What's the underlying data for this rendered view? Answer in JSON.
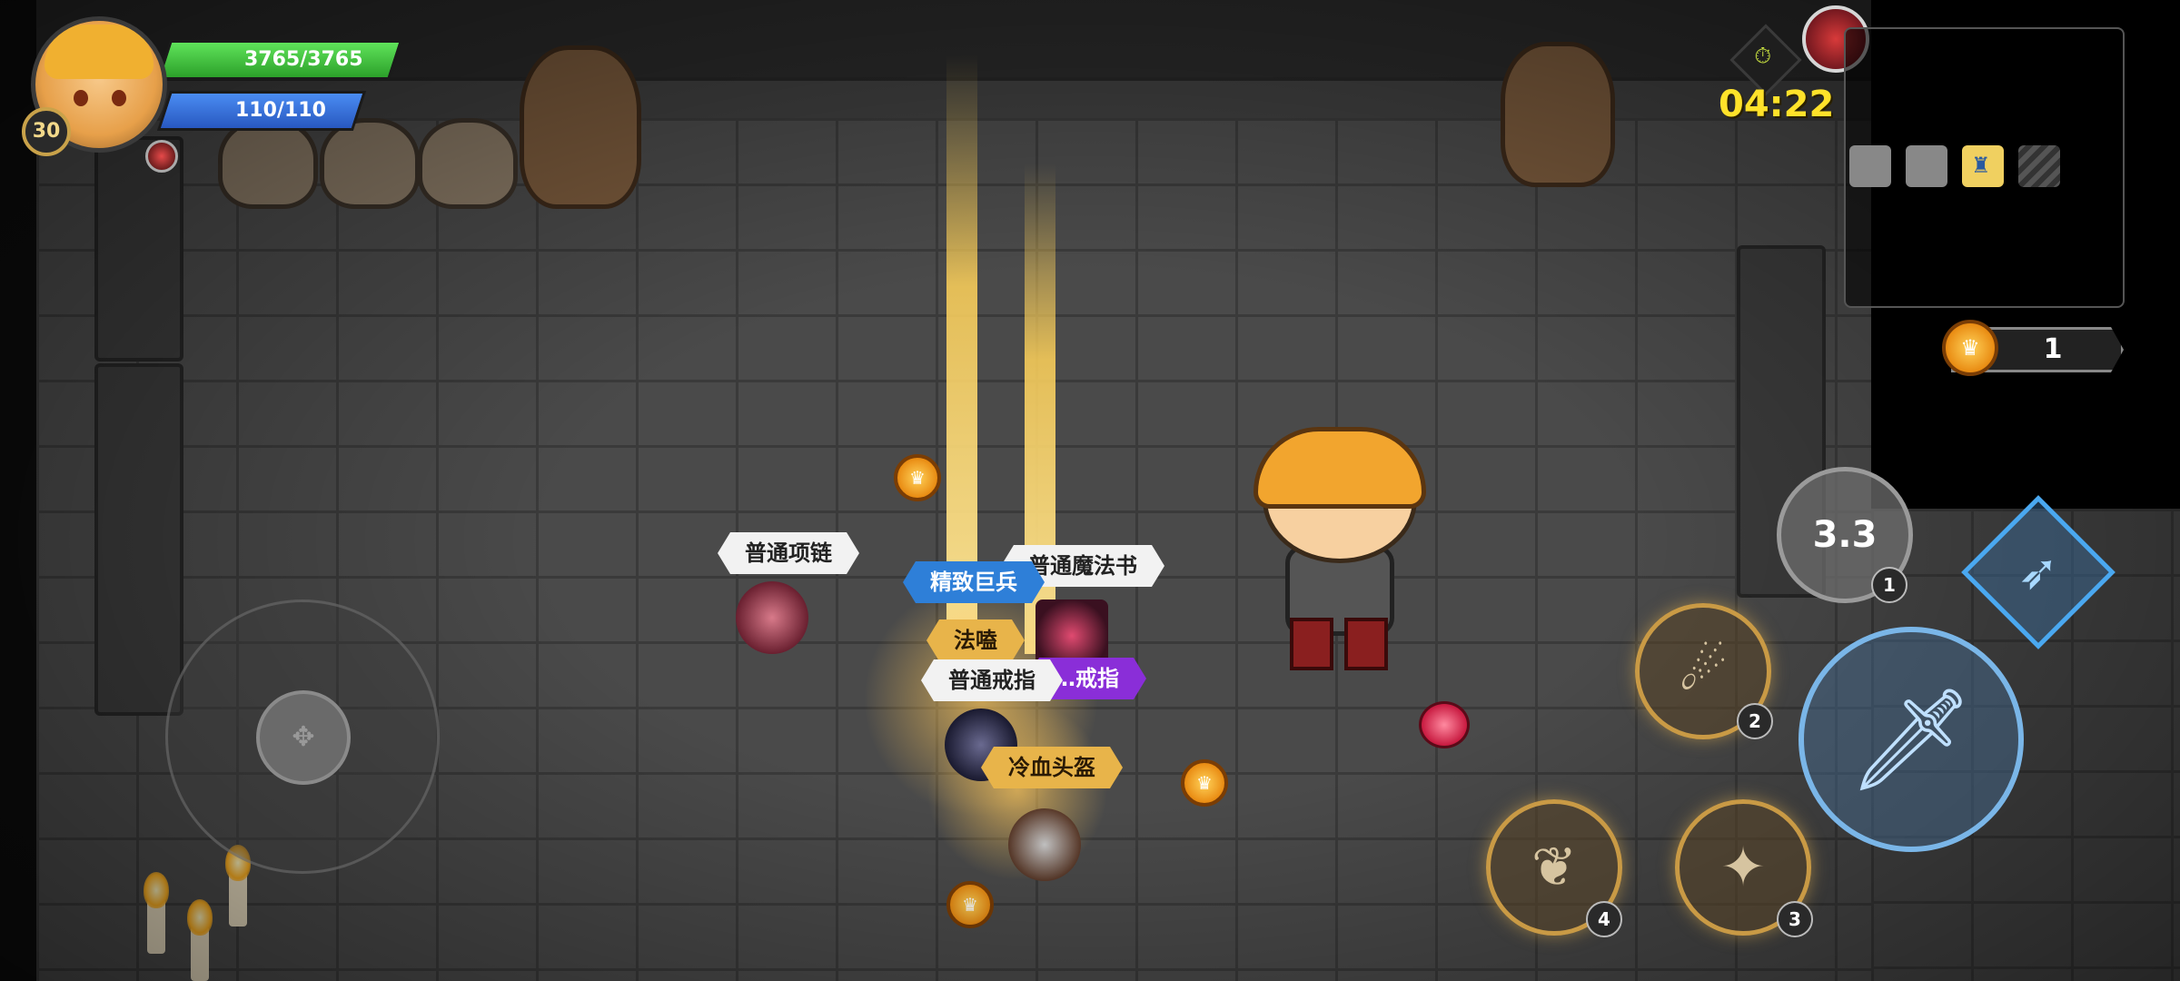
{
  "player": {
    "level": "30",
    "hp_text": "3765/3765",
    "mp_text": "110/110"
  },
  "run": {
    "timer": "04:22",
    "timer_icon": "stopwatch-icon",
    "boss_icon": "demon-boss-icon"
  },
  "minimap": {
    "rooms": [
      {
        "state": "explored"
      },
      {
        "state": "explored"
      },
      {
        "state": "current",
        "icon": "shrine-icon",
        "glyph": "♜"
      },
      {
        "state": "locked"
      }
    ]
  },
  "currency": {
    "gold": "1",
    "icon": "crown-coin-icon",
    "glyph": "♛"
  },
  "drops": {
    "labels": {
      "necklace": "普通项链",
      "spellbook": "普通魔法书",
      "fine_weapon": "精致巨兵",
      "staff": "法嗑",
      "ring_common": "普通戒指",
      "ring_epic": "…戒指",
      "helmet": "冷血头盔"
    }
  },
  "controls": {
    "skills": [
      {
        "slot": "1",
        "cooldown": "3.3",
        "icon": "whirlwind-icon",
        "glyph": "✺"
      },
      {
        "slot": "2",
        "icon": "fire-dash-icon",
        "glyph": "☄"
      },
      {
        "slot": "3",
        "icon": "sprint-icon",
        "glyph": "✦"
      },
      {
        "slot": "4",
        "icon": "meditation-icon",
        "glyph": "❦"
      }
    ],
    "attack": {
      "icon": "sword-icon",
      "glyph": "🗡"
    },
    "dash": {
      "icon": "dodge-icon",
      "glyph": "➶"
    },
    "joystick": {
      "glyph": "✥"
    }
  },
  "colors": {
    "hp": "#3cc43a",
    "mp": "#3b74dd",
    "timer": "#ffe22a",
    "rarity_common": "#f2f2f2",
    "rarity_fine": "#2e7fd8",
    "rarity_rare": "#e8b44a",
    "rarity_epic": "#8a2ed8"
  }
}
